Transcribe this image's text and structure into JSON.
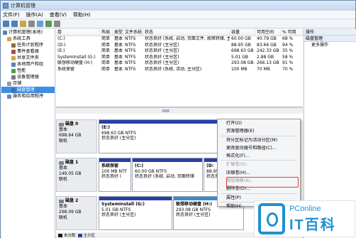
{
  "window": {
    "title": "计算机管理"
  },
  "menu": [
    "文件(F)",
    "操作(A)",
    "查看(V)",
    "帮助(H)"
  ],
  "tree": [
    {
      "label": "计算机管理(本地)",
      "indent": 0,
      "color": "#5b7fb0"
    },
    {
      "label": "系统工具",
      "indent": 1,
      "color": "#c9a64a"
    },
    {
      "label": "任务计划程序",
      "indent": 2,
      "color": "#8c6f3d"
    },
    {
      "label": "事件查看器",
      "indent": 2,
      "color": "#b04a3a"
    },
    {
      "label": "共享文件夹",
      "indent": 2,
      "color": "#c9a64a"
    },
    {
      "label": "本地用户和组",
      "indent": 2,
      "color": "#5a7fb8"
    },
    {
      "label": "性能",
      "indent": 2,
      "color": "#4a9a4a"
    },
    {
      "label": "设备管理器",
      "indent": 2,
      "color": "#7a7a7a"
    },
    {
      "label": "存储",
      "indent": 1,
      "color": "#9a9a9a"
    },
    {
      "label": "磁盘管理",
      "indent": 2,
      "color": "#3d6ea8",
      "selected": true
    },
    {
      "label": "服务和应用程序",
      "indent": 1,
      "color": "#6a8ab0"
    }
  ],
  "volume_table": {
    "headers": [
      "卷",
      "布局",
      "类型",
      "文件系统",
      "状态",
      "容量",
      "可用空间",
      "% 可用"
    ],
    "rows": [
      [
        "(C:)",
        "简单",
        "基本",
        "NTFS",
        "状态良好 (系统, 启动, 页面文件, 故障转储, 主分区)",
        "60.00 GB",
        "40.79 GB",
        "68 %"
      ],
      [
        "(D:)",
        "简单",
        "基本",
        "NTFS",
        "状态良好 (主分区)",
        "88.95 GB",
        "83.66 GB",
        "94 %"
      ],
      [
        "(E:)",
        "简单",
        "基本",
        "NTFS",
        "状态良好 (主分区)",
        "698.63 GB",
        "242.33 GB",
        "35 %"
      ],
      [
        "SystemInstall (G:)",
        "简单",
        "基本",
        "NTFS",
        "状态良好 (主分区)",
        "5.01 GB",
        "2.88 GB",
        "58 %"
      ],
      [
        "联想移动硬盘 (H:)",
        "简单",
        "基本",
        "NTFS",
        "状态良好 (主分区)",
        "293.08 GB",
        "266.13 GB",
        "91 %"
      ],
      [
        "系统保留",
        "简单",
        "基本",
        "NTFS",
        "状态良好 (系统, 活动, 主分区)",
        "100 MB",
        "70 MB",
        "70 %"
      ]
    ]
  },
  "disks": [
    {
      "name": "磁盘 0",
      "type": "基本",
      "size": "698.64 GB",
      "state": "联机",
      "partitions": [
        {
          "name": "(E:)",
          "size": "698.63 GB NTFS",
          "status": "状态良好 (主分区)"
        }
      ]
    },
    {
      "name": "磁盘 1",
      "type": "基本",
      "size": "149.05 GB",
      "state": "联机",
      "partitions": [
        {
          "name": "系统保留",
          "size": "100 MB NTF",
          "status": "状态良好 ("
        },
        {
          "name": "(C:)",
          "size": "60.00 GB NTFS",
          "status": "状态良好 (系统, 启动, 页面转储"
        },
        {
          "name": "(D:",
          "size": "88.95",
          "status": "状态良"
        }
      ]
    },
    {
      "name": "磁盘 2",
      "type": "基本",
      "size": "298.09 GB",
      "state": "联机",
      "partitions": [
        {
          "name": "SystemInstall (G:)",
          "size": "5.01 GB NTFS",
          "status": "状态良好 (主分区)"
        },
        {
          "name": "联想移动硬盘 (H:)",
          "size": "293.08 GB NTFS",
          "status": "状态良好 (主分区)"
        }
      ]
    }
  ],
  "legend": [
    {
      "label": "未分配",
      "color": "#1c1c1c"
    },
    {
      "label": "主分区",
      "color": "#2840a4"
    }
  ],
  "actions": {
    "header1": "操作",
    "header2": "磁盘管理",
    "more": "更多操作"
  },
  "context_menu": [
    {
      "label": "打开(O)"
    },
    {
      "label": "资源管理器(E)"
    },
    {
      "sep": true
    },
    {
      "label": "将分区标记为活动分区(M)"
    },
    {
      "label": "更改驱动器号和路径(C)..."
    },
    {
      "label": "格式化(F)..."
    },
    {
      "sep": true
    },
    {
      "label": "扩展卷(X)...",
      "disabled": true
    },
    {
      "label": "压缩卷(H)..."
    },
    {
      "label": "添加镜像(A)...",
      "disabled": true
    },
    {
      "label": "删除卷(D)..."
    },
    {
      "sep": true
    },
    {
      "label": "属性(P)"
    },
    {
      "sep": true
    },
    {
      "label": "帮助(H)"
    }
  ],
  "watermark": {
    "brand": "PConline",
    "name": "IT百科"
  }
}
